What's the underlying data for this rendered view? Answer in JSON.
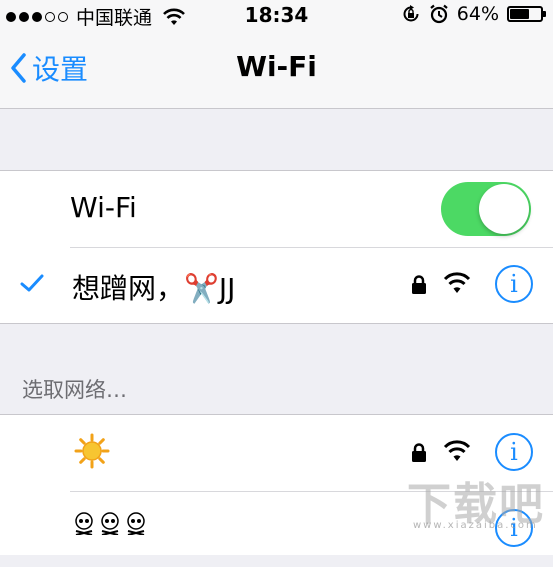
{
  "status_bar": {
    "carrier": "中国联通",
    "time": "18:34",
    "battery_percent": "64%",
    "battery_level": 0.64,
    "signal_bars_filled": 3,
    "signal_bars_total": 5
  },
  "nav": {
    "back_label": "设置",
    "title": "Wi-Fi"
  },
  "wifi_toggle": {
    "label": "Wi-Fi",
    "on": true,
    "accent_color": "#4cd964"
  },
  "connected_network": {
    "name": "想蹭网，✂️JJ",
    "secured": true
  },
  "networks_section": {
    "header": "选取网络…",
    "networks": [
      {
        "name": "sun-emoji",
        "secured": true
      },
      {
        "name": "skull-emoji x3",
        "secured": true
      }
    ]
  },
  "info_glyph": "i",
  "watermark": {
    "text": "下载吧",
    "url": "www.xiazaiba.com"
  },
  "colors": {
    "ios_blue": "#1a8cff",
    "background": "#efeff4"
  }
}
